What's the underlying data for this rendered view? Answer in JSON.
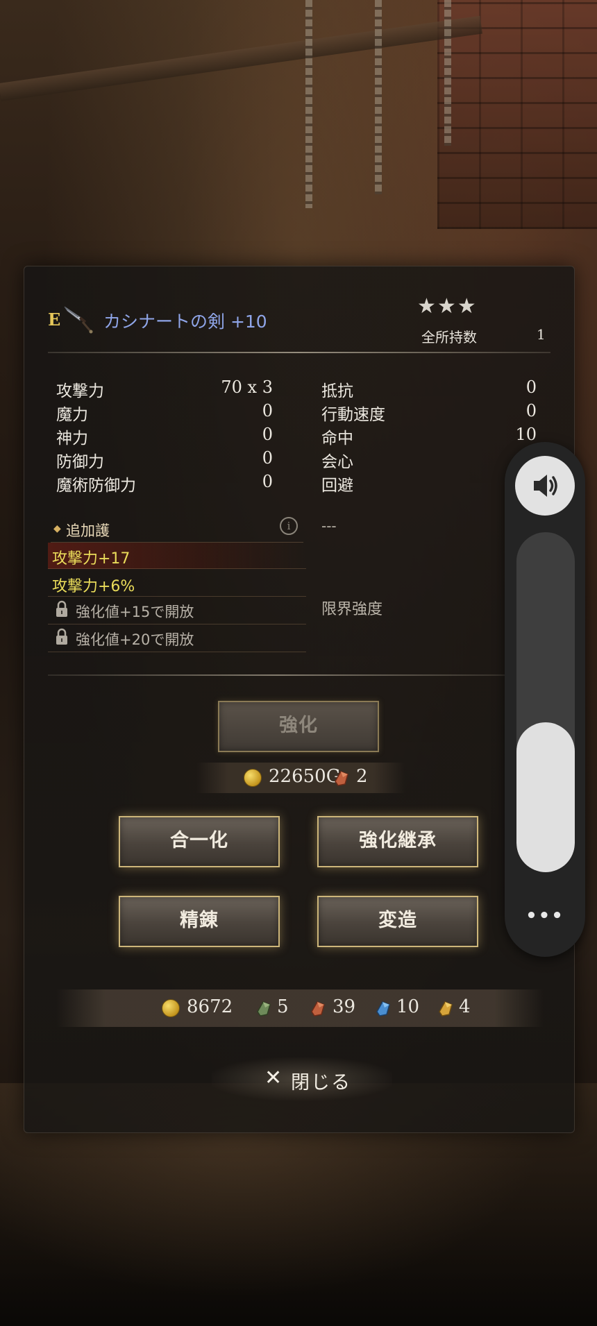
{
  "item": {
    "rank": "E",
    "name": "カシナートの剣 +10",
    "stars": "★★★",
    "owned_label": "全所持数",
    "owned_count": "1",
    "icon": "sword-icon"
  },
  "stats_left": [
    {
      "label": "攻撃力",
      "value": "70 x 3"
    },
    {
      "label": "魔力",
      "value": "0"
    },
    {
      "label": "神力",
      "value": "0"
    },
    {
      "label": "防御力",
      "value": "0"
    },
    {
      "label": "魔術防御力",
      "value": "0"
    }
  ],
  "stats_right": [
    {
      "label": "抵抗",
      "value": "0"
    },
    {
      "label": "行動速度",
      "value": "0"
    },
    {
      "label": "命中",
      "value": "10"
    },
    {
      "label": "会心",
      "value": ""
    },
    {
      "label": "回避",
      "value": ""
    }
  ],
  "extra": {
    "title": "追加護",
    "info_icon": "i",
    "dash": "---",
    "bonuses": [
      "攻撃力+17",
      "攻撃力+6%"
    ],
    "locked": [
      "強化値+15で開放",
      "強化値+20で開放"
    ],
    "limit_label": "限界強度"
  },
  "actions": {
    "enhance": "強化",
    "enhance_cost_gold": "22650G",
    "enhance_cost_material": "2",
    "merge": "合一化",
    "inherit": "強化継承",
    "refine": "精錬",
    "modify": "変造"
  },
  "resources": {
    "gold": "8672",
    "green_ore": "5",
    "red_ore": "39",
    "blue_ore": "10",
    "gold_ore": "4"
  },
  "close": {
    "icon": "✕",
    "label": "閉じる"
  },
  "volume": {
    "speaker_icon": "speaker-icon",
    "note_icon": "music-note-icon",
    "more": "•••",
    "level": 0.44
  },
  "colors": {
    "item_name": "#8fa5e8",
    "bonus_text": "#eadc5a",
    "button_border": "#cdb67a"
  }
}
